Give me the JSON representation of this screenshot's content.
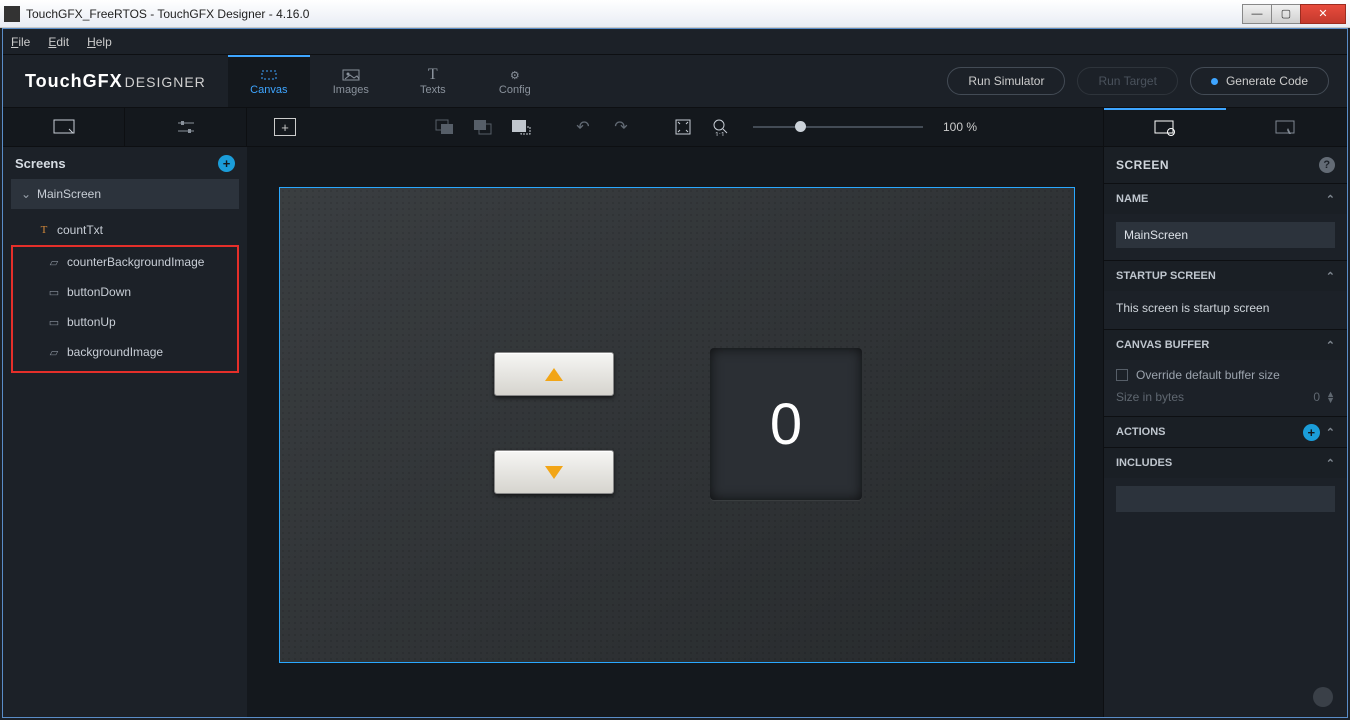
{
  "window": {
    "title": "TouchGFX_FreeRTOS - TouchGFX Designer - 4.16.0"
  },
  "menubar": {
    "file": "File",
    "edit": "Edit",
    "help": "Help"
  },
  "logo": {
    "bold": "TouchGFX",
    "thin": "DESIGNER"
  },
  "maintabs": {
    "canvas": "Canvas",
    "images": "Images",
    "texts": "Texts",
    "config": "Config"
  },
  "actions": {
    "runSimulator": "Run Simulator",
    "runTarget": "Run Target",
    "generateCode": "Generate Code"
  },
  "toolbar": {
    "zoom": "100 %"
  },
  "sidebar": {
    "screens": "Screens",
    "screen_name": "MainScreen",
    "items": [
      "countTxt",
      "counterBackgroundImage",
      "buttonDown",
      "buttonUp",
      "backgroundImage"
    ]
  },
  "canvas": {
    "counter": "0"
  },
  "inspector": {
    "screen": "SCREEN",
    "name_hdr": "NAME",
    "name_val": "MainScreen",
    "startup_hdr": "STARTUP SCREEN",
    "startup_note": "This screen is startup screen",
    "canvasbuf_hdr": "CANVAS BUFFER",
    "override": "Override default buffer size",
    "size_lbl": "Size in bytes",
    "size_val": "0",
    "actions": "ACTIONS",
    "includes": "INCLUDES"
  }
}
